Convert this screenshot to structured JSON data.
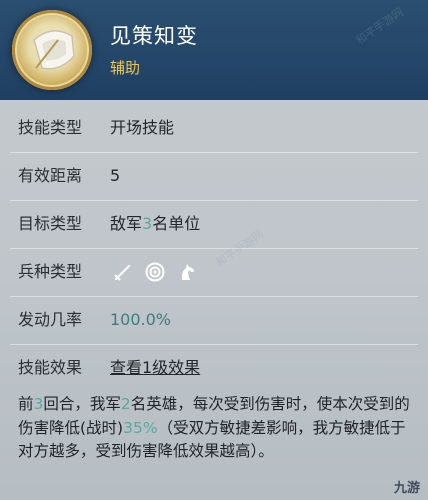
{
  "skill": {
    "name": "见策知变",
    "tag": "辅助"
  },
  "rows": [
    {
      "label": "技能类型",
      "value": "开场技能"
    },
    {
      "label": "有效距离",
      "value": "5"
    },
    {
      "label": "目标类型",
      "value_parts": [
        "敌军",
        "3",
        "名单位"
      ]
    },
    {
      "label": "兵种类型",
      "icons": [
        "sword-icon",
        "target-icon",
        "horse-icon"
      ]
    },
    {
      "label": "发动几率",
      "value": "100.0%"
    },
    {
      "label": "技能效果",
      "link": "查看1级效果"
    }
  ],
  "description": {
    "p1": "前",
    "n1": "3",
    "p2": "回合，我军",
    "n2": "2",
    "p3": "名英雄，每次受到伤害时，使本次受到的伤害降低(战时)",
    "n3": "35%",
    "p4": "（受双方敏捷差影响，我方敏捷低于对方越多，受到伤害降低效果越高）。"
  },
  "watermark": "和平手游网",
  "logo": "九游",
  "colors": {
    "header": "#24466a",
    "highlight": "#5aaa99",
    "link": "#2f9c78",
    "tag": "#f0c64a"
  }
}
